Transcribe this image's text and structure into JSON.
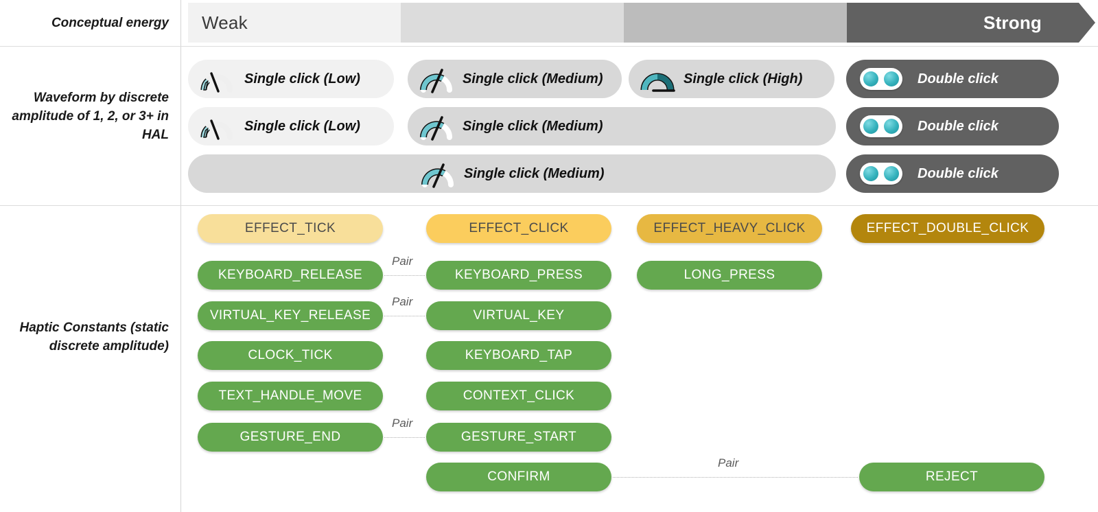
{
  "rows": {
    "energy": {
      "label": "Conceptual energy",
      "weak_label": "Weak",
      "strong_label": "Strong",
      "segment_colors": [
        "#f2f2f2",
        "#dcdcdc",
        "#bcbcbc",
        "#616161"
      ]
    },
    "waveform": {
      "label": "Waveform by discrete amplitude of 1, 2, or 3+ in HAL",
      "items": [
        {
          "text": "Single click (Low)",
          "icon": "gauge-low-icon",
          "tone": "light"
        },
        {
          "text": "Single click (Medium)",
          "icon": "gauge-medium-icon",
          "tone": "mid"
        },
        {
          "text": "Single click (High)",
          "icon": "gauge-high-icon",
          "tone": "mid"
        },
        {
          "text": "Double click",
          "icon": "double-click-toggle-icon",
          "tone": "dark"
        },
        {
          "text": "Single click (Low)",
          "icon": "gauge-low-icon",
          "tone": "light"
        },
        {
          "text": "Single click (Medium)",
          "icon": "gauge-medium-icon",
          "tone": "mid"
        },
        {
          "text": "Double click",
          "icon": "double-click-toggle-icon",
          "tone": "dark"
        },
        {
          "text": "Single click (Medium)",
          "icon": "gauge-medium-icon",
          "tone": "mid"
        },
        {
          "text": "Double click",
          "icon": "double-click-toggle-icon",
          "tone": "dark"
        }
      ]
    },
    "constants": {
      "label": "Haptic Constants (static discrete amplitude)",
      "effects": [
        {
          "text": "EFFECT_TICK",
          "style": "eff1"
        },
        {
          "text": "EFFECT_CLICK",
          "style": "eff2"
        },
        {
          "text": "EFFECT_HEAVY_CLICK",
          "style": "eff3"
        },
        {
          "text": "EFFECT_DOUBLE_CLICK",
          "style": "eff4"
        }
      ],
      "haptics": [
        {
          "text": "KEYBOARD_RELEASE"
        },
        {
          "text": "KEYBOARD_PRESS"
        },
        {
          "text": "LONG_PRESS"
        },
        {
          "text": "VIRTUAL_KEY_RELEASE"
        },
        {
          "text": "VIRTUAL_KEY"
        },
        {
          "text": "CLOCK_TICK"
        },
        {
          "text": "KEYBOARD_TAP"
        },
        {
          "text": "TEXT_HANDLE_MOVE"
        },
        {
          "text": "CONTEXT_CLICK"
        },
        {
          "text": "GESTURE_END"
        },
        {
          "text": "GESTURE_START"
        },
        {
          "text": "CONFIRM"
        },
        {
          "text": "REJECT"
        }
      ],
      "pair_labels": [
        "Pair",
        "Pair",
        "Pair",
        "Pair"
      ]
    }
  },
  "colors": {
    "green": "#64a84f",
    "teal": "#35b2bd",
    "dark_bar": "#616161",
    "amber_dark": "#b3860d"
  }
}
